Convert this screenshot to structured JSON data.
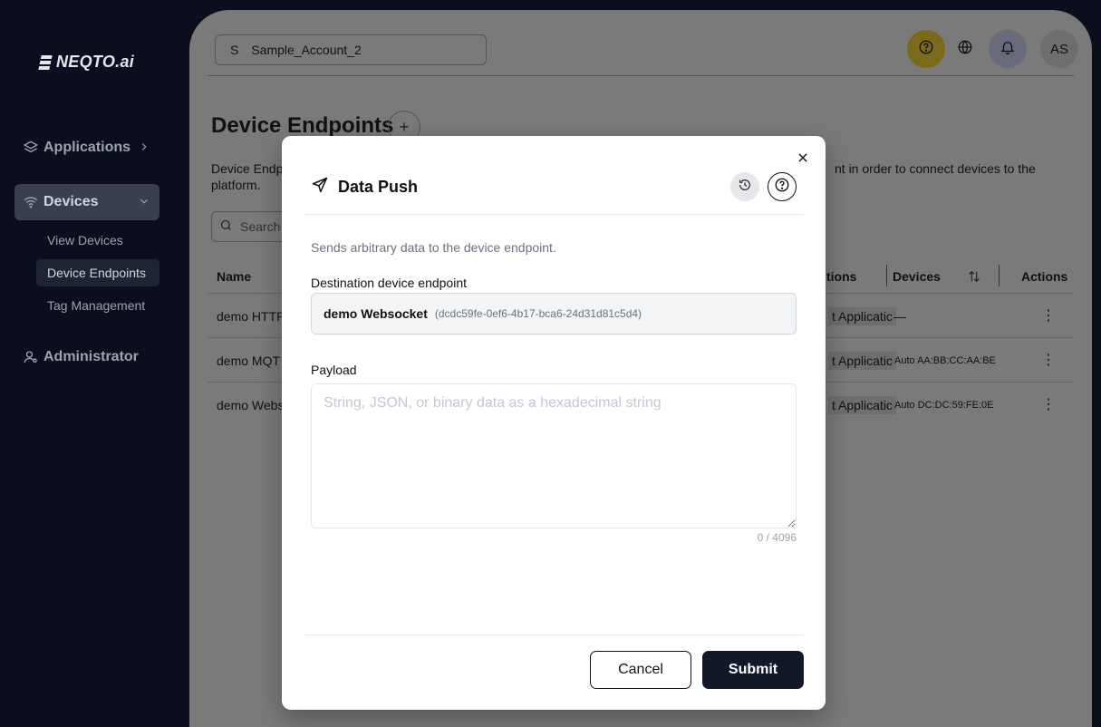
{
  "sidebar": {
    "logo": "NEQTO.ai",
    "items": [
      {
        "label": "Applications"
      },
      {
        "label": "Devices"
      },
      {
        "label": "Administrator"
      }
    ],
    "sub_items": [
      {
        "label": "View Devices"
      },
      {
        "label": "Device Endpoints"
      },
      {
        "label": "Tag Management"
      }
    ]
  },
  "header": {
    "account_initial": "S",
    "account_name": "Sample_Account_2",
    "avatar": "AS"
  },
  "page": {
    "title": "Device Endpoints",
    "description_left": "Device Endp platform.",
    "description_right": "nt in order to connect devices to the",
    "search_placeholder": "Search"
  },
  "table": {
    "headers": {
      "name": "Name",
      "applications": "tions",
      "devices": "Devices",
      "actions": "Actions"
    },
    "rows": [
      {
        "name": "demo HTTP",
        "app": "t Applicatic",
        "device": "—"
      },
      {
        "name": "demo MQT",
        "app": "t Applicatic",
        "device": "Auto AA:BB:CC:AA:BE"
      },
      {
        "name": "demo Webs",
        "app": "t Applicatic",
        "device": "Auto DC:DC:59:FE:0E"
      }
    ]
  },
  "modal": {
    "title": "Data Push",
    "subtitle": "Sends arbitrary data to the device endpoint.",
    "destination_label": "Destination device endpoint",
    "endpoint_name": "demo Websocket",
    "endpoint_id": "(dcdc59fe-0ef6-4b17-bca6-24d31d81c5d4)",
    "payload_label": "Payload",
    "payload_placeholder": "String, JSON, or binary data as a hexadecimal string",
    "payload_value": "",
    "counter": "0 / 4096",
    "cancel_label": "Cancel",
    "submit_label": "Submit"
  },
  "colors": {
    "sidebar_bg": "#0b0e1c",
    "overlay": "#7a7a7a",
    "primary_button": "#111827",
    "help_icon_bg": "#f5c400"
  }
}
